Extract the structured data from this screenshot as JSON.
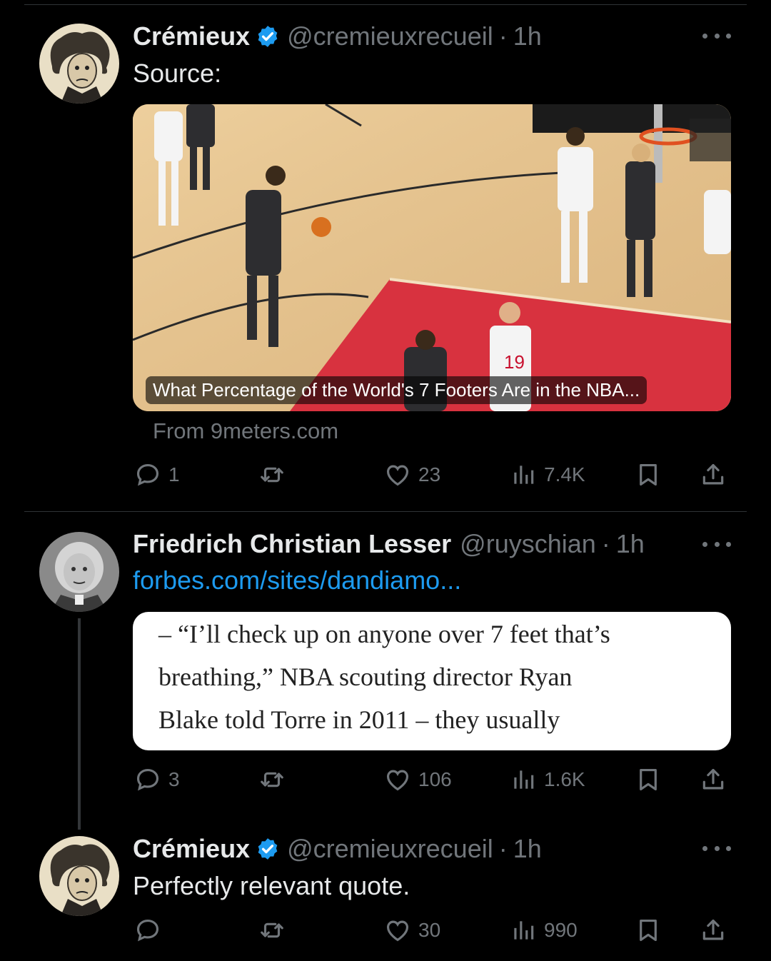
{
  "tweet1": {
    "name": "Crémieux",
    "handle": "@cremieuxrecueil",
    "dot": "·",
    "time": "1h",
    "text": "Source:",
    "card": {
      "caption": "What Percentage of the World's 7 Footers Are in the NBA...",
      "source": "From 9meters.com"
    },
    "actions": {
      "replies": "1",
      "likes": "23",
      "views": "7.4K"
    }
  },
  "tweet2": {
    "name": "Friedrich Christian Lesser",
    "handle": "@ruyschian",
    "dot": "·",
    "time": "1h",
    "link": "forbes.com/sites/dandiamo...",
    "quote_lines": [
      "– “I’ll check up on anyone over 7 feet that’s",
      "breathing,” NBA scouting director Ryan",
      "Blake told Torre in 2011 – they usually"
    ],
    "actions": {
      "replies": "3",
      "likes": "106",
      "views": "1.6K"
    }
  },
  "tweet3": {
    "name": "Crémieux",
    "handle": "@cremieuxrecueil",
    "dot": "·",
    "time": "1h",
    "text": "Perfectly relevant quote.",
    "actions": {
      "likes": "30",
      "views": "990"
    }
  },
  "colors": {
    "background": "#000000",
    "text": "#e7e9ea",
    "muted": "#71767b",
    "link": "#1d9bf0",
    "verified": "#1d9bf0",
    "court_paint": "#e23a4a",
    "court_wood": "#e6c48d"
  },
  "icons": [
    "verified-badge-icon",
    "more-options-icon",
    "reply-icon",
    "retweet-icon",
    "like-icon",
    "views-icon",
    "bookmark-icon",
    "share-icon"
  ]
}
